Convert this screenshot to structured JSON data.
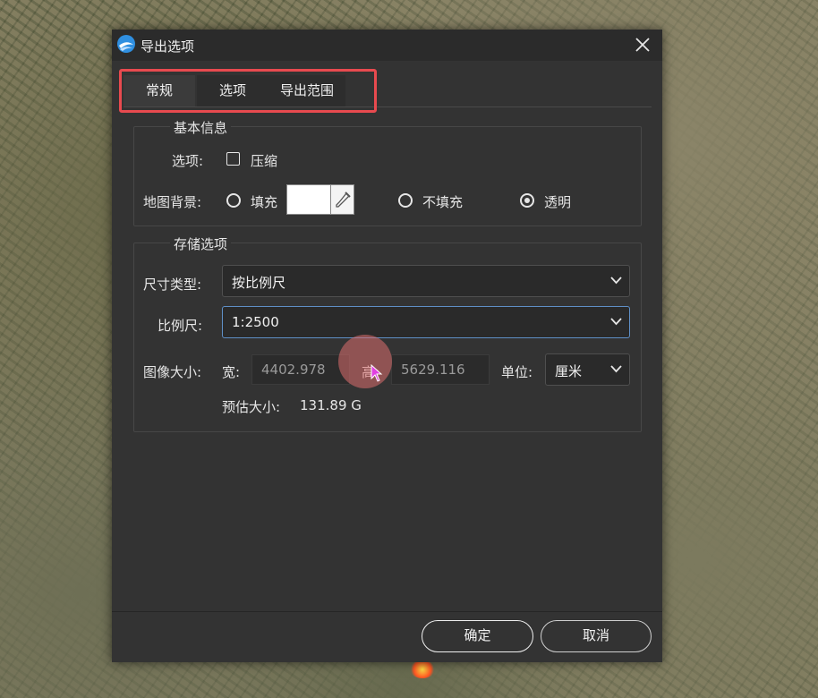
{
  "dialog": {
    "title": "导出选项",
    "tabs": [
      {
        "label": "常规"
      },
      {
        "label": "选项"
      },
      {
        "label": "导出范围"
      }
    ],
    "basic_info": {
      "group_title": "基本信息",
      "options_label": "选项:",
      "compress_label": "压缩",
      "compress_checked": false,
      "background_label": "地图背景:",
      "fill_label": "填充",
      "no_fill_label": "不填充",
      "transparent_label": "透明",
      "background_selected": "透明",
      "fill_color": "#ffffff"
    },
    "storage": {
      "group_title": "存储选项",
      "size_type_label": "尺寸类型:",
      "size_type_value": "按比例尺",
      "scale_label": "比例尺:",
      "scale_value": "1:2500",
      "image_size_label": "图像大小:",
      "width_label": "宽:",
      "width_value": "4402.978",
      "height_label": "高:",
      "height_value": "5629.116",
      "unit_label": "单位:",
      "unit_value": "厘米",
      "estimate_label": "预估大小:",
      "estimate_value": "131.89 G"
    },
    "buttons": {
      "ok": "确定",
      "cancel": "取消"
    }
  },
  "colors": {
    "dialog_bg": "#333333",
    "highlight": "#e84a4f",
    "focus_border": "#5f8fc6"
  }
}
